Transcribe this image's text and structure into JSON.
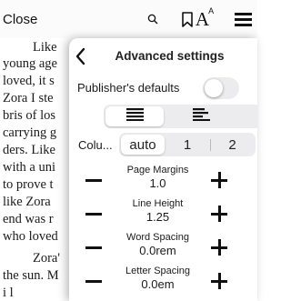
{
  "toolbar": {
    "close_label": "Close",
    "font_icon_main": "A",
    "font_icon_sup": "A",
    "icons": [
      "search-icon",
      "bookmark-icon",
      "font-settings-icon",
      "menu-icon"
    ]
  },
  "book": {
    "lines": [
      "Like ",
      "young age",
      "loved, it s",
      "Zora I ste",
      "bris of los",
      "carrying g",
      "ders. Like",
      "with a uni",
      "to prove t",
      "like Zora",
      "end was r",
      "who loved",
      "Zora'",
      "the sun. M",
      "i    l"
    ]
  },
  "panel": {
    "title": "Advanced settings",
    "back_icon": "chevron-left-icon",
    "publisher_defaults": {
      "label": "Publisher's defaults",
      "on": false
    },
    "alignment": {
      "options": [
        "justify",
        "left"
      ],
      "selected": "justify"
    },
    "columns": {
      "label": "Colu...",
      "options": [
        "auto",
        "1",
        "2"
      ],
      "selected": "auto"
    },
    "steppers": [
      {
        "name": "Page Margins",
        "value": "1.0"
      },
      {
        "name": "Line Height",
        "value": "1.25"
      },
      {
        "name": "Word Spacing",
        "value": "0.0rem"
      },
      {
        "name": "Letter Spacing",
        "value": "0.0em"
      }
    ]
  },
  "colors": {
    "toggle_off": "#ececee",
    "segment_bg": "#ececee",
    "text": "#111111"
  }
}
